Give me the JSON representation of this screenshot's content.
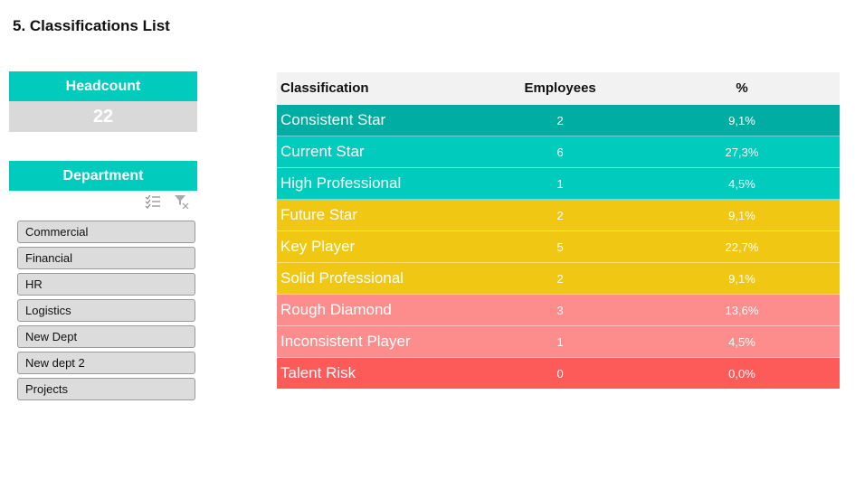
{
  "page": {
    "title": "5. Classifications List"
  },
  "headcount": {
    "label": "Headcount",
    "value": "22"
  },
  "department_slicer": {
    "label": "Department",
    "tools": [
      {
        "icon": "multi-select-icon"
      },
      {
        "icon": "clear-filter-icon"
      }
    ],
    "items": [
      "Commercial",
      "Financial",
      "HR",
      "Logistics",
      "New Dept",
      "New dept 2",
      "Projects"
    ]
  },
  "table": {
    "headers": [
      "Classification",
      "Employees",
      "%"
    ],
    "rows": [
      {
        "classification": "Consistent Star",
        "employees": "2",
        "percent": "9,1%",
        "color": "#00ada2"
      },
      {
        "classification": "Current Star",
        "employees": "6",
        "percent": "27,3%",
        "color": "#00cbbd"
      },
      {
        "classification": "High Professional",
        "employees": "1",
        "percent": "4,5%",
        "color": "#00cbbd"
      },
      {
        "classification": "Future Star",
        "employees": "2",
        "percent": "9,1%",
        "color": "#f0c713"
      },
      {
        "classification": "Key Player",
        "employees": "5",
        "percent": "22,7%",
        "color": "#f0c713"
      },
      {
        "classification": "Solid Professional",
        "employees": "2",
        "percent": "9,1%",
        "color": "#f0c713"
      },
      {
        "classification": "Rough Diamond",
        "employees": "3",
        "percent": "13,6%",
        "color": "#fd8c8c"
      },
      {
        "classification": "Inconsistent Player",
        "employees": "1",
        "percent": "4,5%",
        "color": "#fd8c8c"
      },
      {
        "classification": "Talent Risk",
        "employees": "0",
        "percent": "0,0%",
        "color": "#fd5a5a"
      }
    ]
  }
}
